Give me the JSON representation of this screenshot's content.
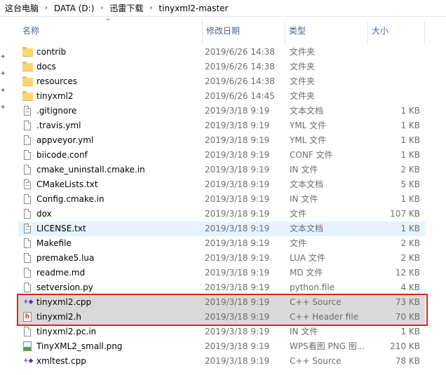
{
  "breadcrumb": [
    "这台电脑",
    "DATA (D:)",
    "迅雷下载",
    "tinyxml2-master"
  ],
  "columns": {
    "name": "名称",
    "date": "修改日期",
    "type": "类型",
    "size": "大小"
  },
  "rows": [
    {
      "name": "contrib",
      "date": "2019/6/26 14:38",
      "type": "文件夹",
      "size": "",
      "icon": "folder-icon"
    },
    {
      "name": "docs",
      "date": "2019/6/26 14:38",
      "type": "文件夹",
      "size": "",
      "icon": "folder-icon"
    },
    {
      "name": "resources",
      "date": "2019/6/26 14:38",
      "type": "文件夹",
      "size": "",
      "icon": "folder-icon"
    },
    {
      "name": "tinyxml2",
      "date": "2019/6/26 14:45",
      "type": "文件夹",
      "size": "",
      "icon": "folder-icon"
    },
    {
      "name": ".gitignore",
      "date": "2019/3/18 9:19",
      "type": "文本文档",
      "size": "1 KB",
      "icon": "text-file-icon"
    },
    {
      "name": ".travis.yml",
      "date": "2019/3/18 9:19",
      "type": "YML 文件",
      "size": "1 KB",
      "icon": "file-icon"
    },
    {
      "name": "appveyor.yml",
      "date": "2019/3/18 9:19",
      "type": "YML 文件",
      "size": "1 KB",
      "icon": "file-icon"
    },
    {
      "name": "biicode.conf",
      "date": "2019/3/18 9:19",
      "type": "CONF 文件",
      "size": "1 KB",
      "icon": "file-icon"
    },
    {
      "name": "cmake_uninstall.cmake.in",
      "date": "2019/3/18 9:19",
      "type": "IN 文件",
      "size": "2 KB",
      "icon": "file-icon"
    },
    {
      "name": "CMakeLists.txt",
      "date": "2019/3/18 9:19",
      "type": "文本文档",
      "size": "5 KB",
      "icon": "text-file-icon"
    },
    {
      "name": "Config.cmake.in",
      "date": "2019/3/18 9:19",
      "type": "IN 文件",
      "size": "1 KB",
      "icon": "file-icon"
    },
    {
      "name": "dox",
      "date": "2019/3/18 9:19",
      "type": "文件",
      "size": "107 KB",
      "icon": "file-icon"
    },
    {
      "name": "LICENSE.txt",
      "date": "2019/3/18 9:19",
      "type": "文本文档",
      "size": "1 KB",
      "icon": "text-file-icon"
    },
    {
      "name": "Makefile",
      "date": "2019/3/18 9:19",
      "type": "文件",
      "size": "2 KB",
      "icon": "file-icon"
    },
    {
      "name": "premake5.lua",
      "date": "2019/3/18 9:19",
      "type": "LUA 文件",
      "size": "2 KB",
      "icon": "file-icon"
    },
    {
      "name": "readme.md",
      "date": "2019/3/18 9:19",
      "type": "MD 文件",
      "size": "12 KB",
      "icon": "file-icon"
    },
    {
      "name": "setversion.py",
      "date": "2019/3/18 9:19",
      "type": "python.file",
      "size": "4 KB",
      "icon": "file-icon"
    },
    {
      "name": "tinyxml2.cpp",
      "date": "2019/3/18 9:19",
      "type": "C++ Source",
      "size": "73 KB",
      "icon": "cpp-source-icon"
    },
    {
      "name": "tinyxml2.h",
      "date": "2019/3/18 9:19",
      "type": "C++ Header file",
      "size": "70 KB",
      "icon": "header-file-icon"
    },
    {
      "name": "tinyxml2.pc.in",
      "date": "2019/3/18 9:19",
      "type": "IN 文件",
      "size": "1 KB",
      "icon": "file-icon"
    },
    {
      "name": "TinyXML2_small.png",
      "date": "2019/3/18 9:19",
      "type": "WPS看图 PNG 图...",
      "size": "210 KB",
      "icon": "image-file-icon"
    },
    {
      "name": "xmltest.cpp",
      "date": "2019/3/18 9:19",
      "type": "C++ Source",
      "size": "78 KB",
      "icon": "cpp-source-icon"
    }
  ]
}
